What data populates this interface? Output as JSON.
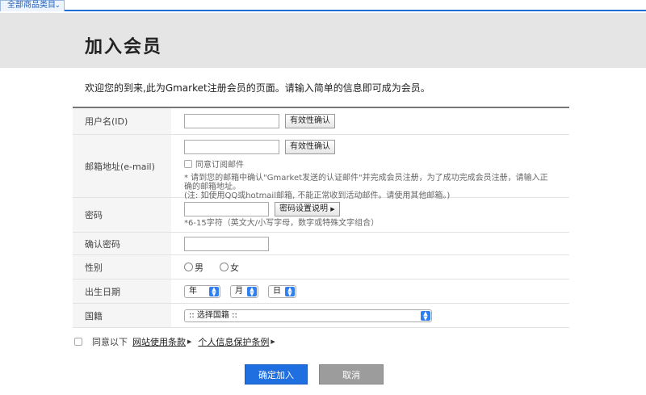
{
  "nav": {
    "category_tab": "全部商品类目"
  },
  "page": {
    "title": "加入会员",
    "welcome": "欢迎您的到来,此为Gmarket注册会员的页面。请输入简单的信息即可成为会员。"
  },
  "form": {
    "userid": {
      "label": "用户名(ID)",
      "value": "",
      "check_button": "有效性确认"
    },
    "email": {
      "label": "邮箱地址(e-mail)",
      "value": "",
      "check_button": "有效性确认",
      "subscribe_label": "同意订阅邮件",
      "note1": "* 请到您的邮箱中确认\"Gmarket发送的认证邮件\"并完成会员注册，为了成功完成会员注册，请输入正确的邮箱地址。",
      "note2": "(注: 如使用QQ或hotmail邮箱, 不能正常收到活动邮件。请使用其他邮箱。)"
    },
    "password": {
      "label": "密码",
      "value": "",
      "help_button": "密码设置说明",
      "hint": "*6-15字符（英文大/小写字母，数字或特殊文字组合）"
    },
    "confirm_password": {
      "label": "确认密码",
      "value": ""
    },
    "gender": {
      "label": "性别",
      "male": "男",
      "female": "女"
    },
    "birthdate": {
      "label": "出生日期",
      "year": "年",
      "month": "月",
      "day": "日"
    },
    "nationality": {
      "label": "国籍",
      "selected": ":: 选择国籍 ::"
    }
  },
  "terms": {
    "agree_prefix": "同意以下",
    "link1": "网站使用条款",
    "link2": "个人信息保护条例"
  },
  "actions": {
    "confirm": "确定加入",
    "cancel": "取消"
  },
  "colors": {
    "accent": "#1f6fe0",
    "cancel": "#9c9c9c",
    "hero_bg": "#e5e5e5"
  }
}
